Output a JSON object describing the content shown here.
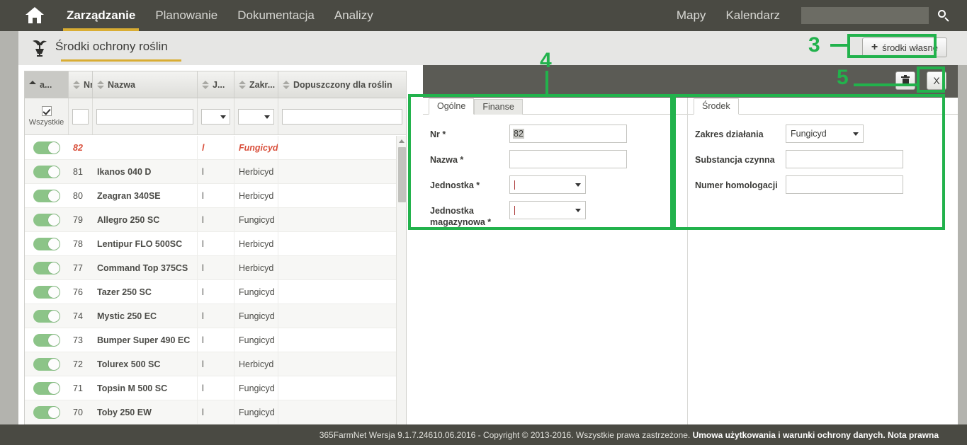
{
  "app": {
    "accent_gold": "#d9ad33",
    "annotation_green": "#22b24c",
    "header_bg": "#4a4a43"
  },
  "topnav": {
    "home_icon": "home-icon",
    "items": [
      {
        "label": "Zarządzanie",
        "active": true
      },
      {
        "label": "Planowanie",
        "active": false
      },
      {
        "label": "Dokumentacja",
        "active": false
      },
      {
        "label": "Analizy",
        "active": false
      }
    ],
    "right_items": [
      {
        "label": "Mapy"
      },
      {
        "label": "Kalendarz"
      }
    ],
    "search": {
      "value": "",
      "placeholder": ""
    },
    "search_icon": "search-icon"
  },
  "subheader": {
    "page_icon": "plant-protection-icon",
    "title": "Środki ochrony roślin",
    "add_button": {
      "plus": "+",
      "label": "środki własne"
    }
  },
  "table": {
    "columns": [
      {
        "key": "active",
        "label": "a...",
        "sort": "asc"
      },
      {
        "key": "nr",
        "label": "Nr",
        "sort": "none"
      },
      {
        "key": "name",
        "label": "Nazwa",
        "sort": "none"
      },
      {
        "key": "unit",
        "label": "J...",
        "sort": "none"
      },
      {
        "key": "scope",
        "label": "Zakr...",
        "sort": "none"
      },
      {
        "key": "allowed",
        "label": "Dopuszczony dla roślin",
        "sort": "none"
      }
    ],
    "filters": {
      "active_checkbox_checked": true,
      "active_label": "Wszystkie",
      "nr": "",
      "name": "",
      "unit_selected": "",
      "scope_selected": "",
      "allowed": ""
    },
    "rows": [
      {
        "on": true,
        "nr": "82",
        "name": "",
        "unit": "l",
        "scope": "Fungicyd",
        "allowed": "",
        "highlight": true
      },
      {
        "on": true,
        "nr": "81",
        "name": "Ikanos 040 D",
        "unit": "l",
        "scope": "Herbicyd",
        "allowed": "",
        "highlight": false
      },
      {
        "on": true,
        "nr": "80",
        "name": "Zeagran 340SE",
        "unit": "l",
        "scope": "Herbicyd",
        "allowed": "",
        "highlight": false
      },
      {
        "on": true,
        "nr": "79",
        "name": "Allegro 250 SC",
        "unit": "l",
        "scope": "Fungicyd",
        "allowed": "",
        "highlight": false
      },
      {
        "on": true,
        "nr": "78",
        "name": "Lentipur FLO 500SC",
        "unit": "l",
        "scope": "Herbicyd",
        "allowed": "",
        "highlight": false
      },
      {
        "on": true,
        "nr": "77",
        "name": "Command Top 375CS",
        "unit": "l",
        "scope": "Herbicyd",
        "allowed": "",
        "highlight": false
      },
      {
        "on": true,
        "nr": "76",
        "name": "Tazer 250 SC",
        "unit": "l",
        "scope": "Fungicyd",
        "allowed": "",
        "highlight": false
      },
      {
        "on": true,
        "nr": "74",
        "name": "Mystic 250 EC",
        "unit": "l",
        "scope": "Fungicyd",
        "allowed": "",
        "highlight": false
      },
      {
        "on": true,
        "nr": "73",
        "name": "Bumper Super 490 EC",
        "unit": "l",
        "scope": "Fungicyd",
        "allowed": "",
        "highlight": false
      },
      {
        "on": true,
        "nr": "72",
        "name": "Tolurex 500 SC",
        "unit": "l",
        "scope": "Herbicyd",
        "allowed": "",
        "highlight": false
      },
      {
        "on": true,
        "nr": "71",
        "name": "Topsin M 500 SC",
        "unit": "l",
        "scope": "Fungicyd",
        "allowed": "",
        "highlight": false
      },
      {
        "on": true,
        "nr": "70",
        "name": "Toby 250 EW",
        "unit": "l",
        "scope": "Fungicyd",
        "allowed": "",
        "highlight": false
      }
    ]
  },
  "detail": {
    "toolbar": {
      "delete_icon": "trash-icon",
      "close_label": "X"
    },
    "left": {
      "tabs": [
        {
          "label": "Ogólne",
          "active": true
        },
        {
          "label": "Finanse",
          "active": false
        }
      ],
      "fields": [
        {
          "label": "Nr *",
          "type": "text",
          "value": "82"
        },
        {
          "label": "Nazwa *",
          "type": "text",
          "value": ""
        },
        {
          "label": "Jednostka *",
          "type": "select",
          "value": ""
        },
        {
          "label": "Jednostka magazynowa *",
          "type": "select",
          "value": ""
        }
      ]
    },
    "right": {
      "tabs": [
        {
          "label": "Środek",
          "active": true
        }
      ],
      "fields": [
        {
          "label": "Zakres działania",
          "type": "select",
          "value": "Fungicyd"
        },
        {
          "label": "Substancja czynna",
          "type": "text",
          "value": ""
        },
        {
          "label": "Numer homologacji",
          "type": "text",
          "value": ""
        }
      ]
    }
  },
  "annotations": [
    {
      "number": "3",
      "target": "add-own-products-button"
    },
    {
      "number": "4",
      "target": "detail-form-area"
    },
    {
      "number": "5",
      "target": "detail-toolbar-buttons"
    }
  ],
  "footer": {
    "text_normal": "365FarmNet Wersja 9.1.7.24610.06.2016 - Copyright © 2013-2016. Wszystkie prawa zastrzeżone. ",
    "text_bold": "Umowa użytkowania i warunki ochrony danych. Nota prawna"
  }
}
